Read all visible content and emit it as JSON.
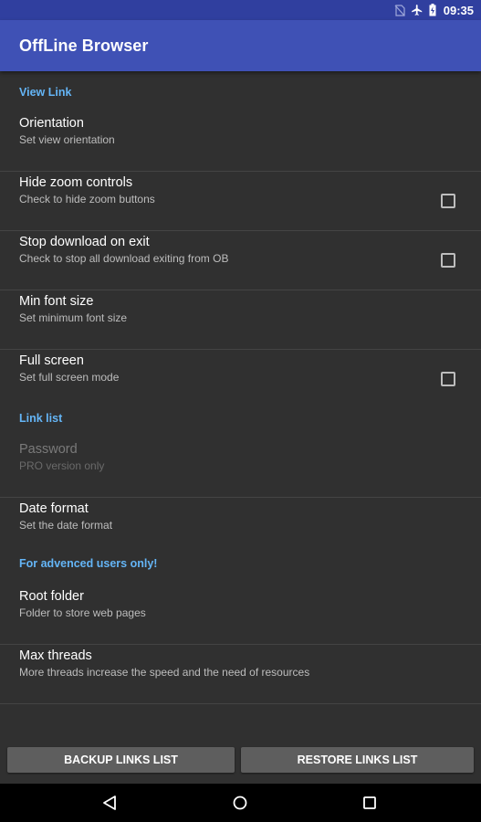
{
  "status_bar": {
    "time": "09:35",
    "icons": [
      "no-sim-icon",
      "airplane-mode-icon",
      "battery-charging-icon"
    ]
  },
  "app_bar": {
    "title": "OffLine Browser"
  },
  "sections": {
    "view_link": {
      "header": "View Link",
      "items": {
        "orientation": {
          "title": "Orientation",
          "summary": "Set view orientation"
        },
        "hide_zoom": {
          "title": "Hide zoom controls",
          "summary": "Check to hide zoom buttons",
          "checked": false
        },
        "stop_download": {
          "title": "Stop download on exit",
          "summary": "Check to stop all download exiting from OB",
          "checked": false
        },
        "min_font": {
          "title": "Min font size",
          "summary": "Set minimum font size"
        },
        "full_screen": {
          "title": "Full screen",
          "summary": "Set full screen mode",
          "checked": false
        }
      }
    },
    "link_list": {
      "header": "Link list",
      "items": {
        "password": {
          "title": "Password",
          "summary": "PRO version only",
          "enabled": false
        },
        "date_format": {
          "title": "Date format",
          "summary": "Set the date format"
        }
      }
    },
    "advanced": {
      "header": "For advenced users only!",
      "items": {
        "root_folder": {
          "title": "Root folder",
          "summary": "Folder to store web pages"
        },
        "max_threads": {
          "title": "Max threads",
          "summary": "More threads increase the speed and the need of resources"
        }
      }
    }
  },
  "buttons": {
    "backup": "BACKUP LINKS LIST",
    "restore": "RESTORE LINKS LIST"
  },
  "colors": {
    "primary": "#3F51B5",
    "primary_dark": "#303F9F",
    "accent": "#64B5F6",
    "background": "#303030"
  }
}
